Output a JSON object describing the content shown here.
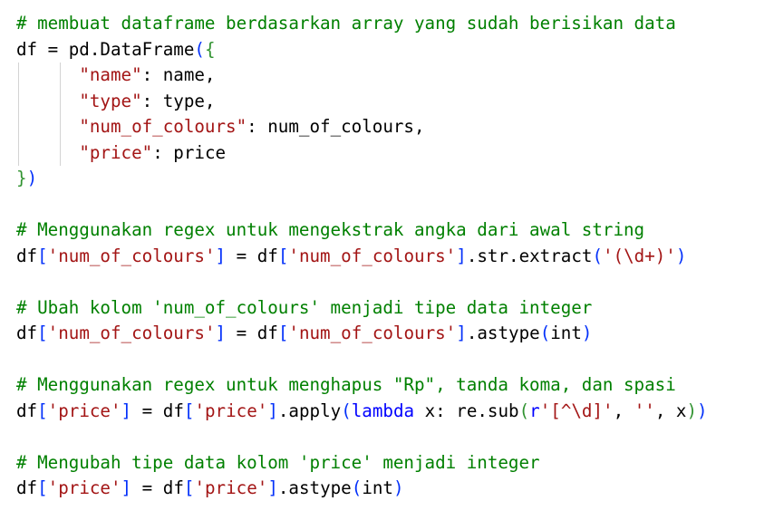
{
  "colors": {
    "comment": "#008000",
    "string": "#a31515",
    "keyword": "#0000ff",
    "bracket_level_1": "#0431fa",
    "bracket_level_2": "#319331"
  },
  "code_lines": [
    [
      {
        "t": "# membuat dataframe berdasarkan array yang sudah berisikan data",
        "c": "comment"
      }
    ],
    [
      {
        "t": "df = pd.DataFrame",
        "c": "plain"
      },
      {
        "t": "(",
        "c": "b0"
      },
      {
        "t": "{",
        "c": "b1"
      }
    ],
    [
      {
        "t": "      ",
        "c": "plain",
        "indent": true
      },
      {
        "t": "\"name\"",
        "c": "string"
      },
      {
        "t": ": name,",
        "c": "plain"
      }
    ],
    [
      {
        "t": "      ",
        "c": "plain",
        "indent": true
      },
      {
        "t": "\"type\"",
        "c": "string"
      },
      {
        "t": ": type,",
        "c": "plain"
      }
    ],
    [
      {
        "t": "      ",
        "c": "plain",
        "indent": true
      },
      {
        "t": "\"num_of_colours\"",
        "c": "string"
      },
      {
        "t": ": num_of_colours,",
        "c": "plain"
      }
    ],
    [
      {
        "t": "      ",
        "c": "plain",
        "indent": true
      },
      {
        "t": "\"price\"",
        "c": "string"
      },
      {
        "t": ": price",
        "c": "plain"
      }
    ],
    [
      {
        "t": "}",
        "c": "b1"
      },
      {
        "t": ")",
        "c": "b0"
      }
    ],
    [],
    [
      {
        "t": "# Menggunakan regex untuk mengekstrak angka dari awal string",
        "c": "comment"
      }
    ],
    [
      {
        "t": "df",
        "c": "plain"
      },
      {
        "t": "[",
        "c": "b0"
      },
      {
        "t": "'num_of_colours'",
        "c": "string"
      },
      {
        "t": "]",
        "c": "b0"
      },
      {
        "t": " = df",
        "c": "plain"
      },
      {
        "t": "[",
        "c": "b0"
      },
      {
        "t": "'num_of_colours'",
        "c": "string"
      },
      {
        "t": "]",
        "c": "b0"
      },
      {
        "t": ".str.extract",
        "c": "plain"
      },
      {
        "t": "(",
        "c": "b0"
      },
      {
        "t": "'(\\d+)'",
        "c": "string"
      },
      {
        "t": ")",
        "c": "b0"
      }
    ],
    [],
    [
      {
        "t": "# Ubah kolom 'num_of_colours' menjadi tipe data integer",
        "c": "comment"
      }
    ],
    [
      {
        "t": "df",
        "c": "plain"
      },
      {
        "t": "[",
        "c": "b0"
      },
      {
        "t": "'num_of_colours'",
        "c": "string"
      },
      {
        "t": "]",
        "c": "b0"
      },
      {
        "t": " = df",
        "c": "plain"
      },
      {
        "t": "[",
        "c": "b0"
      },
      {
        "t": "'num_of_colours'",
        "c": "string"
      },
      {
        "t": "]",
        "c": "b0"
      },
      {
        "t": ".astype",
        "c": "plain"
      },
      {
        "t": "(",
        "c": "b0"
      },
      {
        "t": "int",
        "c": "plain"
      },
      {
        "t": ")",
        "c": "b0"
      }
    ],
    [],
    [
      {
        "t": "# Menggunakan regex untuk menghapus \"Rp\", tanda koma, dan spasi",
        "c": "comment"
      }
    ],
    [
      {
        "t": "df",
        "c": "plain"
      },
      {
        "t": "[",
        "c": "b0"
      },
      {
        "t": "'price'",
        "c": "string"
      },
      {
        "t": "]",
        "c": "b0"
      },
      {
        "t": " = df",
        "c": "plain"
      },
      {
        "t": "[",
        "c": "b0"
      },
      {
        "t": "'price'",
        "c": "string"
      },
      {
        "t": "]",
        "c": "b0"
      },
      {
        "t": ".apply",
        "c": "plain"
      },
      {
        "t": "(",
        "c": "b0"
      },
      {
        "t": "lambda",
        "c": "keyword"
      },
      {
        "t": " x: re.sub",
        "c": "plain"
      },
      {
        "t": "(",
        "c": "b1"
      },
      {
        "t": "r",
        "c": "keyword"
      },
      {
        "t": "'[^\\d]'",
        "c": "string"
      },
      {
        "t": ", ",
        "c": "plain"
      },
      {
        "t": "''",
        "c": "string"
      },
      {
        "t": ", x",
        "c": "plain"
      },
      {
        "t": ")",
        "c": "b1"
      },
      {
        "t": ")",
        "c": "b0"
      }
    ],
    [],
    [
      {
        "t": "# Mengubah tipe data kolom 'price' menjadi integer",
        "c": "comment"
      }
    ],
    [
      {
        "t": "df",
        "c": "plain"
      },
      {
        "t": "[",
        "c": "b0"
      },
      {
        "t": "'price'",
        "c": "string"
      },
      {
        "t": "]",
        "c": "b0"
      },
      {
        "t": " = df",
        "c": "plain"
      },
      {
        "t": "[",
        "c": "b0"
      },
      {
        "t": "'price'",
        "c": "string"
      },
      {
        "t": "]",
        "c": "b0"
      },
      {
        "t": ".astype",
        "c": "plain"
      },
      {
        "t": "(",
        "c": "b0"
      },
      {
        "t": "int",
        "c": "plain"
      },
      {
        "t": ")",
        "c": "b0"
      }
    ]
  ]
}
